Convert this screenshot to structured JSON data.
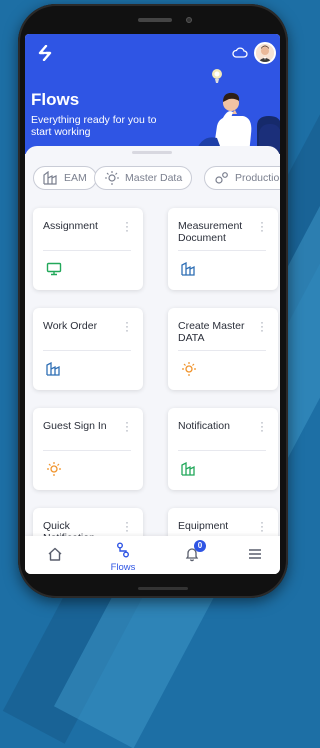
{
  "header": {
    "logo": "S",
    "title": "Flows",
    "subtitle": "Everything ready for you to start working"
  },
  "filters": [
    {
      "label": "EAM",
      "icon": "factory-icon"
    },
    {
      "label": "Master Data",
      "icon": "bulb-icon"
    },
    {
      "label": "Production",
      "icon": "gears-icon"
    }
  ],
  "cards": [
    {
      "title": "Assignment",
      "icon": "monitor-icon",
      "color": "#22a85a"
    },
    {
      "title": "Measurement Document",
      "icon": "factory-icon",
      "color": "#2f6fb5"
    },
    {
      "title": "Work Order",
      "icon": "factory-icon",
      "color": "#2f6fb5"
    },
    {
      "title": "Create Master DATA",
      "icon": "bulb-icon",
      "color": "#f0932b"
    },
    {
      "title": "Guest Sign In",
      "icon": "bulb-icon",
      "color": "#f0932b"
    },
    {
      "title": "Notification",
      "icon": "factory-icon",
      "color": "#22a85a"
    },
    {
      "title": "Quick Notification",
      "icon": "",
      "color": ""
    },
    {
      "title": "Equipment",
      "icon": "",
      "color": ""
    }
  ],
  "nav": {
    "flows_label": "Flows",
    "notification_count": "0"
  },
  "colors": {
    "primary": "#2f55e4",
    "background": "#f5f6fa"
  }
}
